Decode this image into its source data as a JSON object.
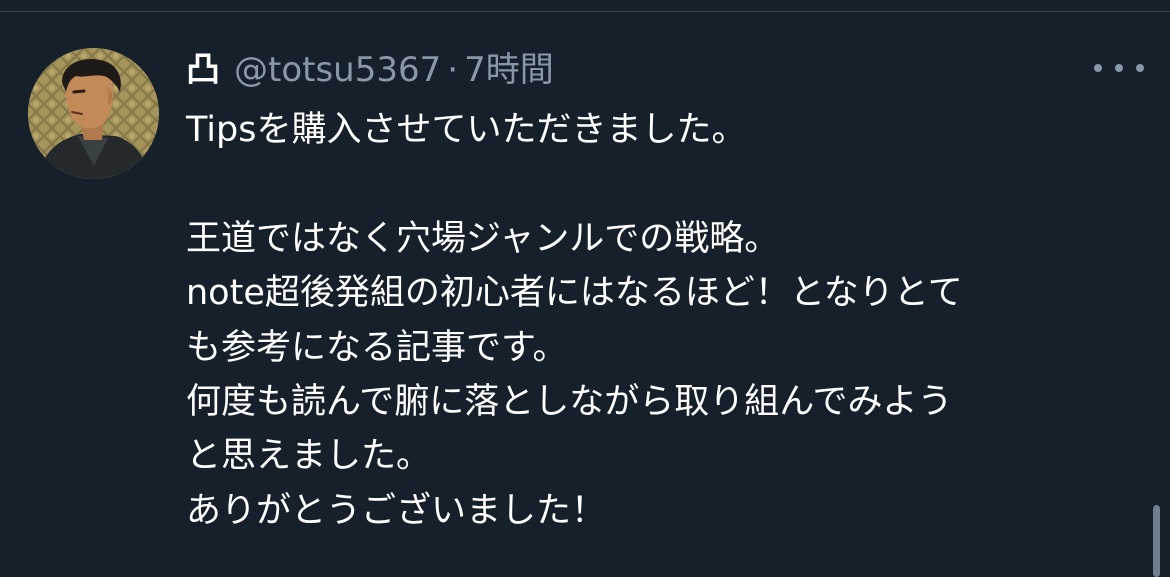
{
  "tweet": {
    "display_name": "凸",
    "handle": "@totsu5367",
    "separator": "·",
    "time": "7時間",
    "more_icon": "more-horizontal-icon",
    "lines": [
      "Tipsを購入させていただきました。",
      "",
      "王道ではなく穴場ジャンルでの戦略。",
      "note超後発組の初心者にはなるほど！となりとて",
      "も参考になる記事です。",
      "何度も読んで腑に落としながら取り組んでみよう",
      "と思えました。",
      "ありがとうございました！"
    ]
  },
  "colors": {
    "background": "#15202b",
    "text": "#ffffff",
    "secondary": "#8899a6",
    "divider": "#38444d"
  }
}
